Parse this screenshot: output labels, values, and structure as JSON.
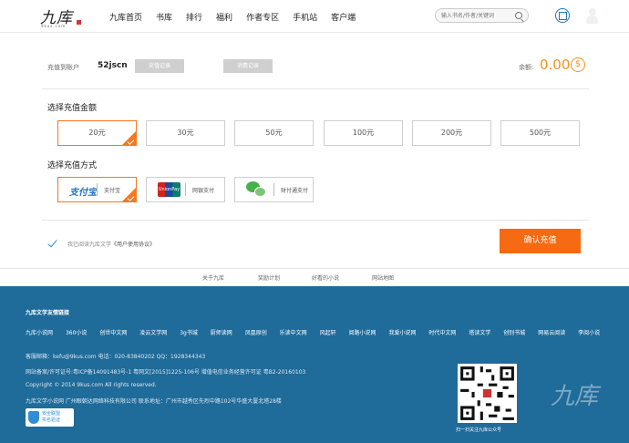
{
  "header": {
    "logo_text": "九库",
    "logo_sub": "9kus.com",
    "nav": [
      "九库首页",
      "书库",
      "排行",
      "福利",
      "作者专区",
      "手机站",
      "客户端"
    ],
    "search_placeholder": "输入书名/作者/关键词"
  },
  "account": {
    "label": "充值到账户",
    "username": "52jscn",
    "recharge_record": "充值记录",
    "consume_record": "消费记录",
    "balance_label": "余额:",
    "balance_value": "0.00",
    "coin_symbol": "$"
  },
  "amount_section": {
    "title": "选择充值金额",
    "options": [
      "20元",
      "30元",
      "50元",
      "100元",
      "200元",
      "500元"
    ],
    "selected_index": 0
  },
  "pay_section": {
    "title": "选择充值方式",
    "methods": [
      {
        "logo": "支付宝",
        "label": "支付宝",
        "icon": "alipay-icon"
      },
      {
        "logo": "UnionPay",
        "label": "网银支付",
        "icon": "unionpay-icon"
      },
      {
        "logo": "",
        "label": "财付通支付",
        "icon": "wechat-icon"
      }
    ],
    "selected_index": 0
  },
  "agreement": {
    "text": "我已阅读九库文学",
    "link": "《用户使用协议》"
  },
  "confirm_label": "确认充值",
  "sub_links": [
    "关于九库",
    "奖励计划",
    "好看的小说",
    "网站地图"
  ],
  "footer": {
    "title": "九库文学友情链接",
    "partners": [
      "九库小说网",
      "360小说",
      "创世中文网",
      "凌云文学网",
      "3g书城",
      "厨师读网",
      "凤凰原创",
      "乐读中文网",
      "风起轩",
      "阅路小说网",
      "我爱小说网",
      "时代中文网",
      "塔读文学",
      "创别书城",
      "网易云阅读",
      "李阅小说"
    ],
    "contact": "客服邮箱：kefu@9kus.com  电话：020-83840202  QQ：1928344343",
    "license": "网站备案/许可证号:粤ICP备14091483号-1    粤网文[2015]1225-106号    增值电信业务经营许可证    粤B2-20160103",
    "copyright": "Copyright © 2014 9kus.com All rights reserved.",
    "company": "九库文学小说网  广州眼朝达网络科技有限公司  联系地址：广州市越秀区先烈中路102号华盛大厦北塔28楼",
    "safe_badge_line1": "安全联盟",
    "safe_badge_line2": "实名验证",
    "qr_caption": "扫一扫关注九库公众号",
    "footer_logo": "九库"
  },
  "colors": {
    "accent_orange": "#f56a12",
    "footer_blue": "#1f6b99",
    "link_blue": "#1e8ad6"
  }
}
